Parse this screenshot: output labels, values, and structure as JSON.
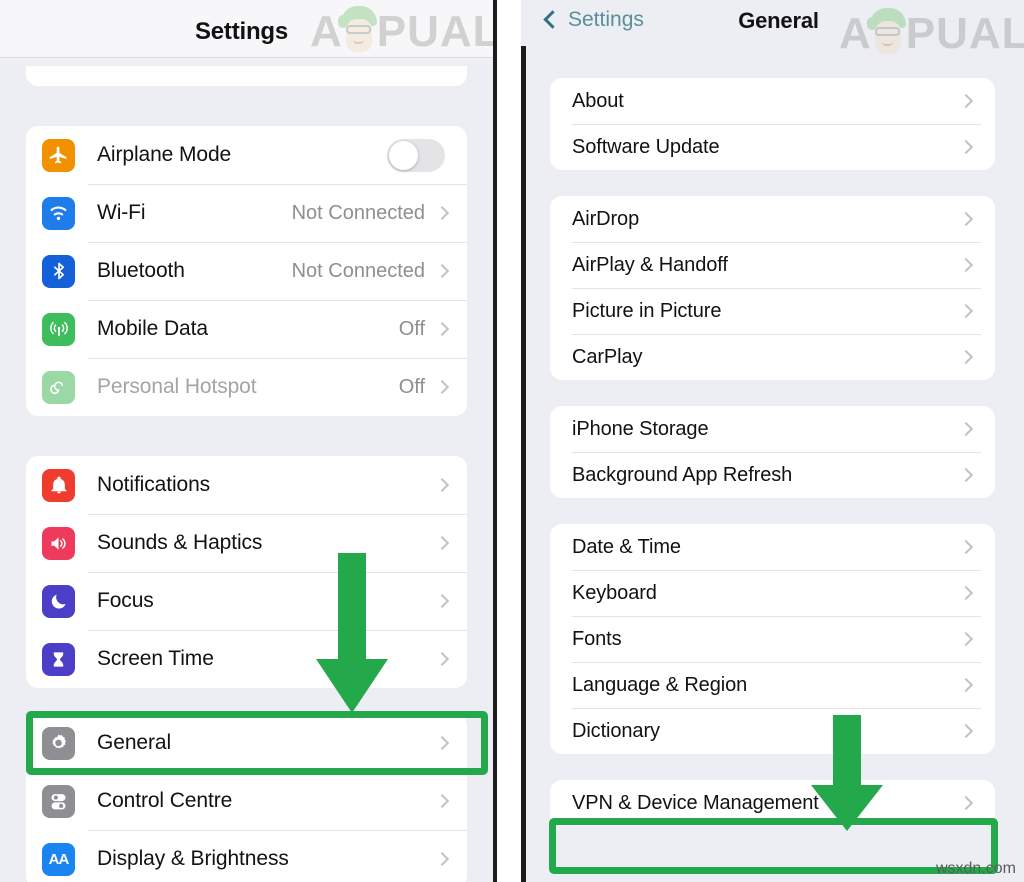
{
  "brand": {
    "logo_text": "PUALS",
    "logo_prefix": "A",
    "watermark": "wsxdn.com"
  },
  "left_panel": {
    "nav": {
      "title": "Settings"
    },
    "groups": [
      {
        "name": "connectivity",
        "rows": [
          {
            "label": "Airplane Mode",
            "icon": "airplane-icon",
            "glyph": "✈",
            "icon_color": "#f29100",
            "control": "toggle",
            "toggle_on": false
          },
          {
            "label": "Wi-Fi",
            "icon": "wifi-icon",
            "glyph": "◠",
            "icon_color": "#1f7ceb",
            "value": "Not Connected",
            "control": "chevron"
          },
          {
            "label": "Bluetooth",
            "icon": "bluetooth-icon",
            "glyph": "ᛦ",
            "icon_color": "#1360d8",
            "value": "Not Connected",
            "control": "chevron"
          },
          {
            "label": "Mobile Data",
            "icon": "cellular-icon",
            "glyph": "ʃ",
            "icon_color": "#3dbd5c",
            "value": "Off",
            "control": "chevron"
          },
          {
            "label": "Personal Hotspot",
            "icon": "hotspot-icon",
            "glyph": "ʘ",
            "icon_color": "#9ad8a5",
            "value": "Off",
            "control": "chevron",
            "dim": true
          }
        ]
      },
      {
        "name": "notifications",
        "rows": [
          {
            "label": "Notifications",
            "icon": "bell-icon",
            "glyph": "ὑ4",
            "icon_color": "#f03c2e",
            "control": "chevron"
          },
          {
            "label": "Sounds & Haptics",
            "icon": "speaker-icon",
            "glyph": "ὐa",
            "icon_color": "#ef3b5b",
            "control": "chevron"
          },
          {
            "label": "Focus",
            "icon": "moon-icon",
            "glyph": "☾",
            "icon_color": "#4b3fc7",
            "control": "chevron"
          },
          {
            "label": "Screen Time",
            "icon": "hourglass-icon",
            "glyph": "⌛",
            "icon_color": "#4b3fc7",
            "control": "chevron"
          }
        ]
      },
      {
        "name": "system",
        "rows": [
          {
            "label": "General",
            "icon": "gear-icon",
            "glyph": "⚙",
            "icon_color": "#8e8e93",
            "control": "chevron",
            "highlighted": true
          },
          {
            "label": "Control Centre",
            "icon": "control-centre-icon",
            "glyph": "⚙",
            "icon_color": "#8e8e93",
            "control": "chevron"
          },
          {
            "label": "Display & Brightness",
            "icon": "display-brightness-icon",
            "glyph": "AA",
            "icon_color": "#1a84f0",
            "control": "chevron"
          }
        ]
      }
    ]
  },
  "right_panel": {
    "nav": {
      "back_label": "Settings",
      "title": "General"
    },
    "groups": [
      {
        "name": "about-group",
        "rows": [
          {
            "label": "About",
            "control": "chevron"
          },
          {
            "label": "Software Update",
            "control": "chevron"
          }
        ]
      },
      {
        "name": "sharing-group",
        "rows": [
          {
            "label": "AirDrop",
            "control": "chevron"
          },
          {
            "label": "AirPlay & Handoff",
            "control": "chevron"
          },
          {
            "label": "Picture in Picture",
            "control": "chevron"
          },
          {
            "label": "CarPlay",
            "control": "chevron"
          }
        ]
      },
      {
        "name": "storage-group",
        "rows": [
          {
            "label": "iPhone Storage",
            "control": "chevron"
          },
          {
            "label": "Background App Refresh",
            "control": "chevron"
          }
        ]
      },
      {
        "name": "locale-group",
        "rows": [
          {
            "label": "Date & Time",
            "control": "chevron"
          },
          {
            "label": "Keyboard",
            "control": "chevron"
          },
          {
            "label": "Fonts",
            "control": "chevron"
          },
          {
            "label": "Language & Region",
            "control": "chevron"
          },
          {
            "label": "Dictionary",
            "control": "chevron"
          }
        ]
      },
      {
        "name": "vpn-group",
        "rows": [
          {
            "label": "VPN & Device Management",
            "control": "chevron",
            "highlighted": true
          }
        ]
      }
    ]
  },
  "annotations": {
    "accent_color": "#23a94b",
    "left_arrow": {
      "target": "General"
    },
    "right_arrow": {
      "target": "VPN & Device Management"
    },
    "left_highlight": {
      "target": "General"
    },
    "right_highlight": {
      "target": "VPN & Device Management"
    }
  }
}
